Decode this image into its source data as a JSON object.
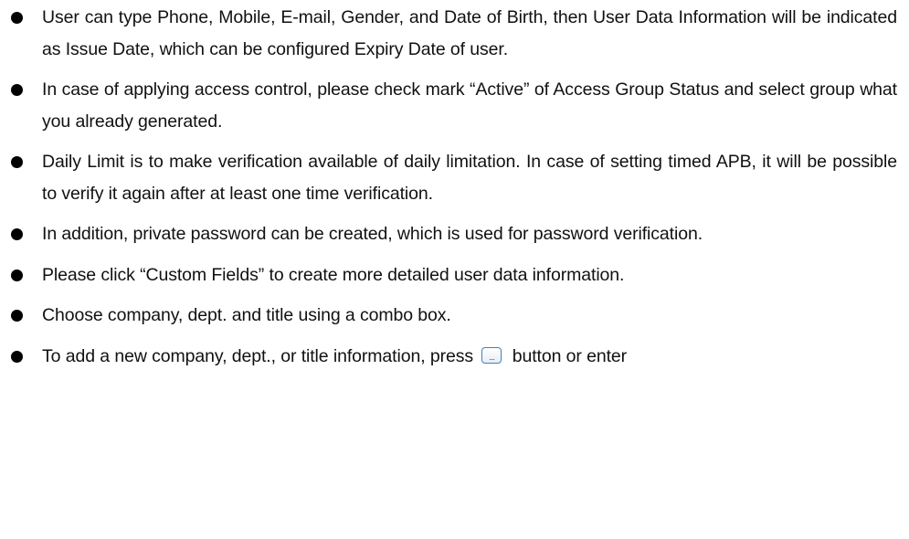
{
  "bullets": [
    {
      "text": "User can type Phone, Mobile, E-mail, Gender, and Date of Birth, then User Data Information will be indicated as Issue Date, which can be configured Expiry Date of user."
    },
    {
      "text": "In case of applying access control, please check mark “Active” of Access Group Status and select group what you already generated."
    },
    {
      "text": "Daily Limit is to make verification available of daily limitation. In case of setting timed APB, it will be possible to verify it again after at least one time verification."
    },
    {
      "text": "In addition, private password can be created, which is used for password verification."
    },
    {
      "text": "Please click “Custom Fields” to create more detailed user data information."
    },
    {
      "text": "Choose company, dept. and title using a combo box."
    },
    {
      "text_before": "To add a new company, dept., or title information, press",
      "button_label": "...",
      "text_after": "button or enter"
    }
  ]
}
